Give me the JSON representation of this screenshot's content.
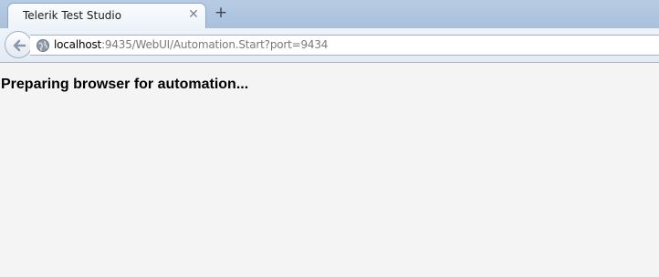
{
  "browser": {
    "tab": {
      "title": "Telerik Test Studio",
      "close_icon": "close-icon",
      "new_tab_icon": "plus-icon"
    },
    "navbar": {
      "back_icon": "back-arrow-icon",
      "site_icon": "globe-icon",
      "url_host": "localhost",
      "url_rest": ":9435/WebUI/Automation.Start?port=9434"
    }
  },
  "page": {
    "heading": "Preparing browser for automation..."
  }
}
